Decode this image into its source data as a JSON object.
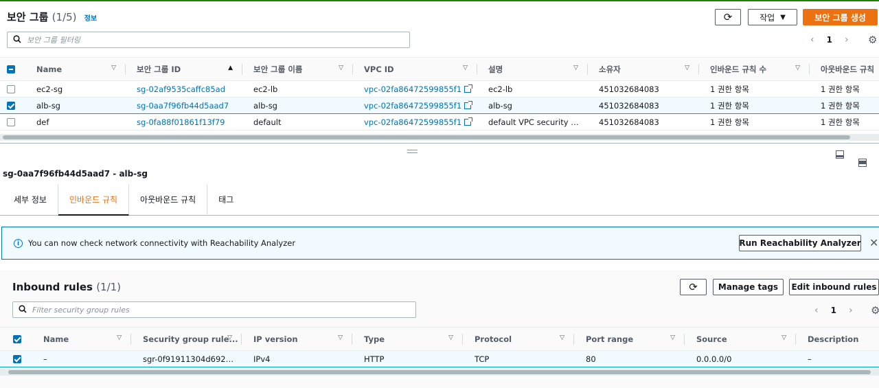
{
  "top": {
    "title": "보안 그룹",
    "count": "(1/5)",
    "info_link": "정보",
    "actions_label": "작업",
    "create_label": "보안 그룹 생성",
    "search_placeholder": "보안 그룹 필터링",
    "page": "1"
  },
  "sg_table": {
    "headers": [
      "Name",
      "보안 그룹 ID",
      "보안 그룹 이름",
      "VPC ID",
      "설명",
      "소유자",
      "인바운드 규칙 수",
      "아웃바운드 규칙"
    ],
    "rows": [
      {
        "name": "ec2-sg",
        "id": "sg-02af9535caffc85ad",
        "group_name": "ec2-lb",
        "vpc": "vpc-02fa86472599855f1",
        "desc": "ec2-lb",
        "owner": "451032684083",
        "inbound": "1 권한 항목",
        "outbound": "1 권한 항목",
        "selected": false
      },
      {
        "name": "alb-sg",
        "id": "sg-0aa7f96fb44d5aad7",
        "group_name": "alb-sg",
        "vpc": "vpc-02fa86472599855f1",
        "desc": "alb-sg",
        "owner": "451032684083",
        "inbound": "1 권한 항목",
        "outbound": "1 권한 항목",
        "selected": true
      },
      {
        "name": "def",
        "id": "sg-0fa88f01861f13f79",
        "group_name": "default",
        "vpc": "vpc-02fa86472599855f1",
        "desc": "default VPC security gr...",
        "owner": "451032684083",
        "inbound": "1 권한 항목",
        "outbound": "1 권한 항목",
        "selected": false
      }
    ]
  },
  "detail": {
    "title": "sg-0aa7f96fb44d5aad7 - alb-sg",
    "tabs": [
      "세부 정보",
      "인바운드 규칙",
      "아웃바운드 규칙",
      "태그"
    ],
    "active_tab": "인바운드 규칙"
  },
  "alert": {
    "message": "You can now check network connectivity with Reachability Analyzer",
    "button": "Run Reachability Analyzer"
  },
  "inbound": {
    "title": "Inbound rules",
    "count": "(1/1)",
    "manage_tags": "Manage tags",
    "edit_rules": "Edit inbound rules",
    "search_placeholder": "Filter security group rules",
    "page": "1",
    "headers": [
      "Name",
      "Security group rule...",
      "IP version",
      "Type",
      "Protocol",
      "Port range",
      "Source",
      "Description"
    ],
    "rows": [
      {
        "name": "–",
        "rule_id": "sgr-0f91911304d6928...",
        "ip_version": "IPv4",
        "type": "HTTP",
        "protocol": "TCP",
        "port": "80",
        "source": "0.0.0.0/0",
        "desc": "–",
        "selected": true
      }
    ]
  },
  "colors": {
    "accent": "#ec7211",
    "link": "#0073bb",
    "success_line": "#1d8102"
  }
}
